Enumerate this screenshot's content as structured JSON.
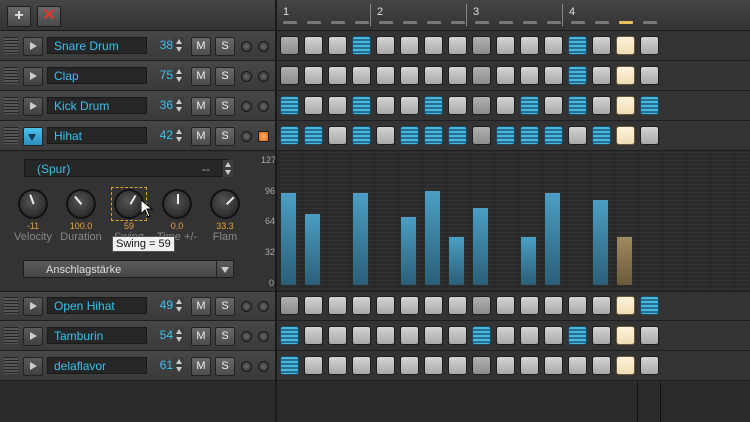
{
  "toolbar": {
    "add_label": "+",
    "remove_label": "✕"
  },
  "ruler": {
    "bars": [
      "1",
      "2",
      "3",
      "4"
    ]
  },
  "tracks": [
    {
      "name": "Snare Drum",
      "velocity": "38",
      "mute": "M",
      "solo": "S"
    },
    {
      "name": "Clap",
      "velocity": "75",
      "mute": "M",
      "solo": "S"
    },
    {
      "name": "Kick Drum",
      "velocity": "36",
      "mute": "M",
      "solo": "S"
    },
    {
      "name": "Hihat",
      "velocity": "42",
      "mute": "M",
      "solo": "S"
    },
    {
      "name": "Open Hihat",
      "velocity": "49",
      "mute": "M",
      "solo": "S"
    },
    {
      "name": "Tamburin",
      "velocity": "54",
      "mute": "M",
      "solo": "S"
    },
    {
      "name": "delaflavor",
      "velocity": "61",
      "mute": "M",
      "solo": "S"
    }
  ],
  "patterns": [
    [
      0,
      0,
      0,
      1,
      0,
      0,
      0,
      0,
      0,
      0,
      0,
      0,
      1,
      0,
      2,
      0
    ],
    [
      0,
      0,
      0,
      0,
      0,
      0,
      0,
      0,
      0,
      0,
      0,
      0,
      1,
      0,
      2,
      0
    ],
    [
      1,
      0,
      0,
      3,
      0,
      0,
      1,
      0,
      0,
      0,
      1,
      0,
      1,
      0,
      2,
      1
    ],
    [
      1,
      1,
      0,
      1,
      0,
      1,
      1,
      1,
      0,
      1,
      1,
      1,
      0,
      1,
      2,
      0
    ],
    [
      0,
      0,
      0,
      0,
      0,
      0,
      0,
      0,
      0,
      0,
      0,
      0,
      0,
      0,
      2,
      1
    ],
    [
      1,
      0,
      0,
      0,
      0,
      0,
      0,
      0,
      1,
      0,
      0,
      0,
      1,
      0,
      2,
      0
    ],
    [
      1,
      0,
      0,
      0,
      0,
      0,
      0,
      0,
      0,
      0,
      0,
      0,
      0,
      0,
      2,
      0
    ]
  ],
  "hihat_panel": {
    "spur_label": "(Spur)",
    "spur_dash": "--",
    "knobs": [
      {
        "label": "Velocity",
        "value": "-11",
        "angle": -20
      },
      {
        "label": "Duration",
        "value": "100.0",
        "angle": -40
      },
      {
        "label": "Swing",
        "value": "59",
        "angle": 30
      },
      {
        "label": "Time +/-",
        "value": "0.0",
        "angle": 0
      },
      {
        "label": "Flam",
        "value": "33.3",
        "angle": 45
      }
    ],
    "tooltip": "Swing = 59",
    "velocity_select": "Anschlagstärke"
  },
  "velocity_graph": {
    "ytick_labels": [
      "127",
      "96",
      "64",
      "32",
      "0"
    ],
    "values": [
      96,
      74,
      0,
      96,
      0,
      71,
      98,
      50,
      80,
      0,
      50,
      96,
      0,
      88,
      50,
      0
    ]
  },
  "colors": {
    "accent": "#38c0ee",
    "step_on": "#47b8e0",
    "current_step": "#f0dcb4",
    "knob_value": "#e8a040"
  }
}
